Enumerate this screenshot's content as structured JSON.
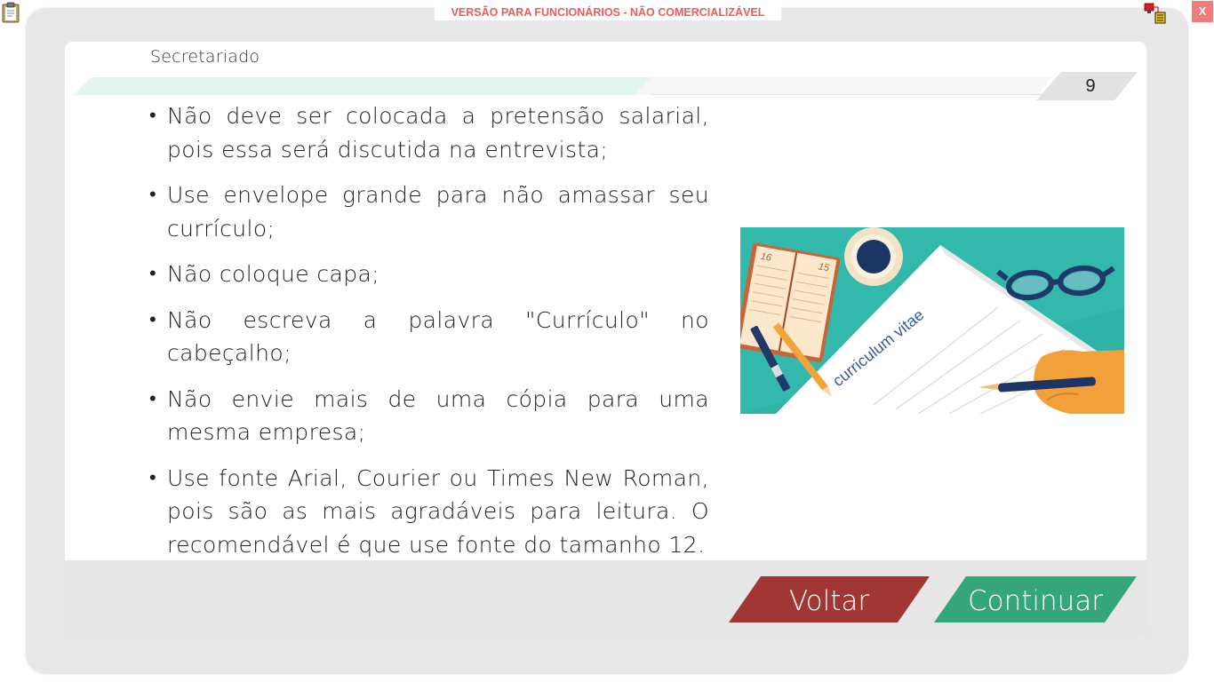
{
  "window": {
    "watermark": "VERSÃO PARA FUNCIONÁRIOS - NÃO COMERCIALIZÁVEL",
    "close_label": "X"
  },
  "slide": {
    "section_title": "Secretariado",
    "page_number": "9",
    "bullets": [
      "Não deve ser colocada a pretensão salarial, pois essa será discutida na entrevista;",
      "Use envelope grande para não amassar seu currículo;",
      "Não coloque capa;",
      "Não escreva a palavra \"Currículo\" no cabeçalho;",
      "Não envie mais de uma cópia para uma mesma empresa;",
      "Use fonte Arial, Courier ou Times New Roman, pois são as mais agradáveis para leitura. O recomendável é que use fonte do tamanho 12."
    ],
    "illustration_text": "curriculum vitae"
  },
  "navigation": {
    "back_label": "Voltar",
    "next_label": "Continuar"
  },
  "colors": {
    "back_button": "#a23634",
    "next_button": "#35a57a",
    "illustration_bg": "#2fb3a6",
    "header_accent": "#dff5ee"
  }
}
